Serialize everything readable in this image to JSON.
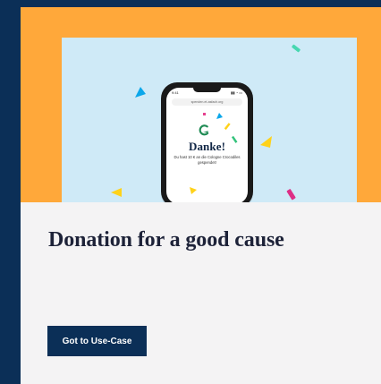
{
  "hero": {
    "phone": {
      "status_time": "9:41",
      "status_icons": "▮▮ ◔ ▭",
      "url": "spenden.et-asfach.org",
      "thanks_title": "Danke!",
      "thanks_message": "Du hast 10 € an die Cologne Crocodiles gespendet!"
    }
  },
  "main": {
    "headline": "Donation for a good cause",
    "cta_label": "Got to Use-Case"
  },
  "colors": {
    "outer_background": "#0b2f57",
    "hero_background": "#ffa83a",
    "hero_inner_background": "#cfeaf7",
    "card_background": "#f4f3f4",
    "cta_background": "#0b2f57",
    "headline_color": "#1d2238"
  }
}
